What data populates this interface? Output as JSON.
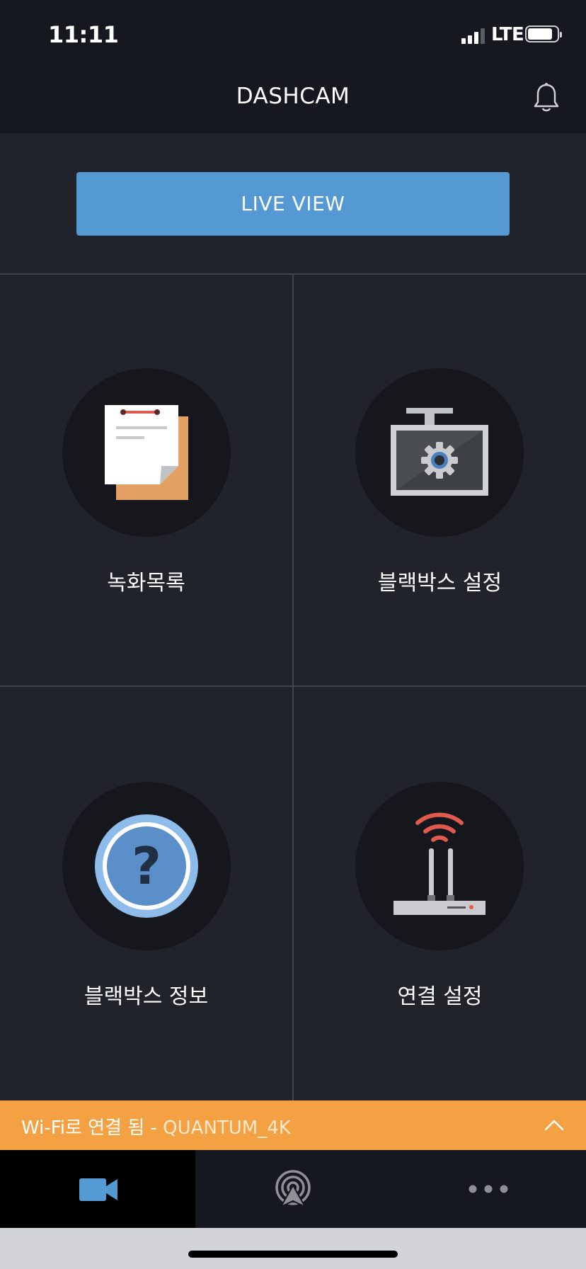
{
  "status_bar": {
    "time": "11:11",
    "network": "LTE"
  },
  "header": {
    "title": "DASHCAM",
    "bell_icon": "bell-icon"
  },
  "live_view": {
    "label": "LIVE VIEW"
  },
  "menu": [
    {
      "label": "녹화목록",
      "icon": "document-list-icon"
    },
    {
      "label": "블랙박스 설정",
      "icon": "dashcam-settings-icon"
    },
    {
      "label": "블랙박스 정보",
      "icon": "help-icon"
    },
    {
      "label": "연결 설정",
      "icon": "wifi-router-icon"
    }
  ],
  "wifi_banner": {
    "prefix": "Wi-Fi로 연결 됨 - ",
    "ssid": "QUANTUM_4K"
  },
  "tabs": [
    {
      "icon": "video-camera-icon",
      "active": true
    },
    {
      "icon": "broadcast-icon",
      "active": false
    },
    {
      "icon": "more-icon",
      "active": false
    }
  ],
  "colors": {
    "accent": "#5498d4",
    "banner": "#f3a142",
    "background": "#20232a",
    "header": "#16181f"
  }
}
